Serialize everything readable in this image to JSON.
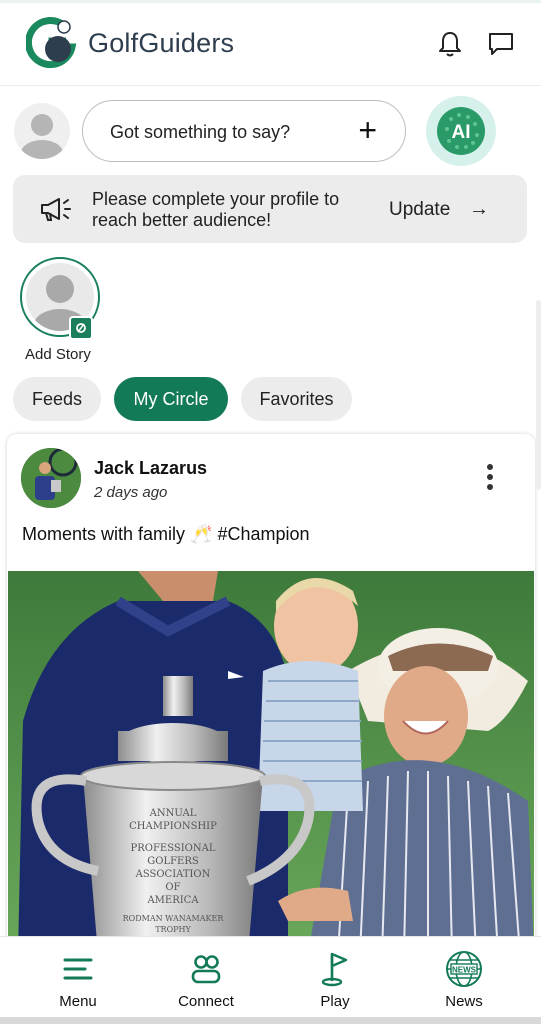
{
  "header": {
    "brand": "GolfGuiders",
    "logo_icon": "golf-ball-g-logo",
    "notifications_icon": "bell-icon",
    "messages_icon": "chat-bubble-icon"
  },
  "composer": {
    "placeholder": "Got something to say?",
    "plus": "+",
    "ai_label": "AI"
  },
  "banner": {
    "text": "Please complete your profile to reach better audience!",
    "action": "Update",
    "arrow": "→",
    "icon": "megaphone-icon"
  },
  "story": {
    "label": "Add Story"
  },
  "tabs": [
    {
      "label": "Feeds",
      "active": false
    },
    {
      "label": "My Circle",
      "active": true
    },
    {
      "label": "Favorites",
      "active": false
    }
  ],
  "post": {
    "author": "Jack Lazarus",
    "time": "2 days ago",
    "text": "Moments with family 🥂 #Champion",
    "image_icon": "family-trophy-photo",
    "trophy_text": "ANNUAL CHAMPIONSHIP PROFESSIONAL GOLFERS ASSOCIATION OF AMERICA RODMAN WANAMAKER TROPHY"
  },
  "nav": [
    {
      "label": "Menu",
      "icon": "menu-icon"
    },
    {
      "label": "Connect",
      "icon": "people-icon"
    },
    {
      "label": "Play",
      "icon": "golf-flag-icon"
    },
    {
      "label": "News",
      "icon": "news-globe-icon"
    }
  ],
  "colors": {
    "accent": "#137a58",
    "chip_bg": "#ececec",
    "ai_bg": "#d6f1ec"
  }
}
